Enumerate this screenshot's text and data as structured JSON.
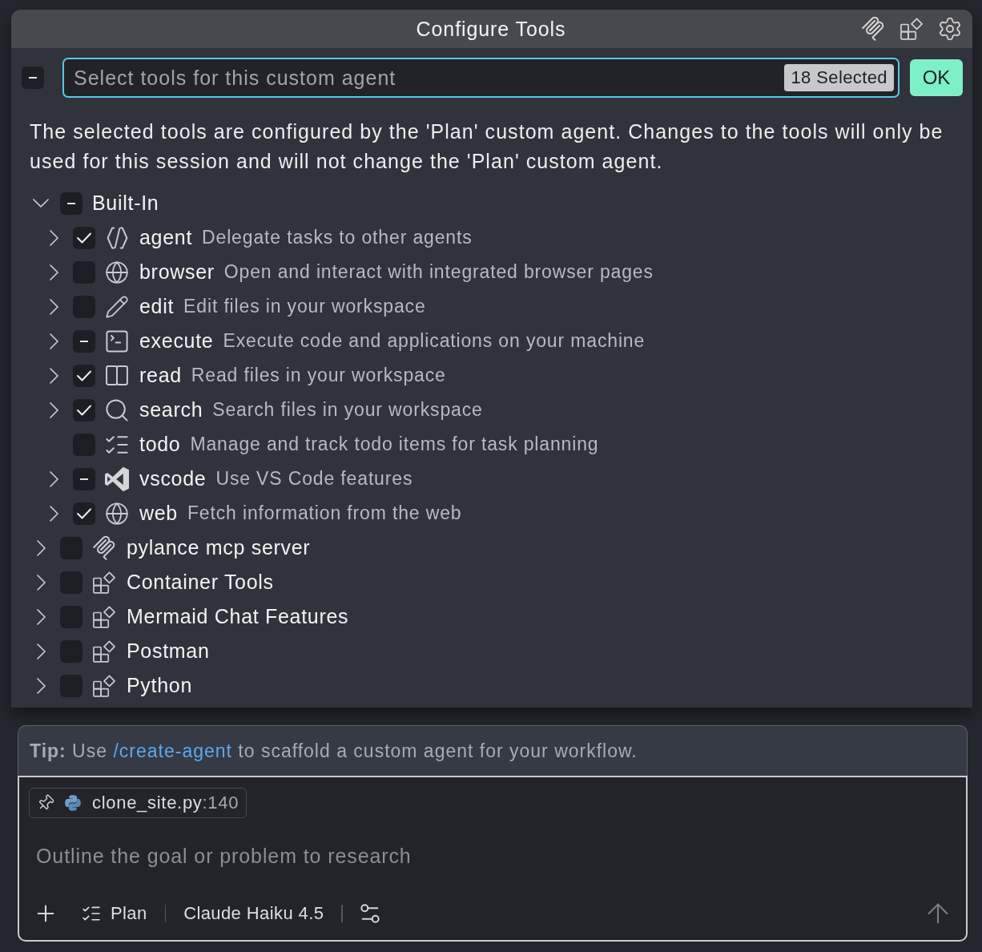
{
  "window": {
    "title": "Configure Tools"
  },
  "toggle_all": {
    "indeterminate": true
  },
  "search": {
    "placeholder": "Select tools for this custom agent",
    "badge": "18 Selected"
  },
  "ok_button": "OK",
  "description": "The selected tools are configured by the 'Plan' custom agent. Changes to the tools will only be used for this session and will not change the 'Plan' custom agent.",
  "tree": [
    {
      "label": "Built-In",
      "kind": "builtin",
      "expanded": true,
      "indeterminate": true,
      "children": [
        {
          "name": "agent",
          "description": "Delegate tasks to other agents",
          "expandable": true,
          "expanded": false,
          "checked": true
        },
        {
          "name": "browser",
          "description": "Open and interact with integrated browser pages",
          "expandable": true,
          "expanded": false,
          "checked": false
        },
        {
          "name": "edit",
          "description": "Edit files in your workspace",
          "expandable": true,
          "expanded": false,
          "checked": false
        },
        {
          "name": "execute",
          "description": "Execute code and applications on your machine",
          "expandable": true,
          "expanded": false,
          "indeterminate": true
        },
        {
          "name": "read",
          "description": "Read files in your workspace",
          "expandable": true,
          "expanded": false,
          "checked": true
        },
        {
          "name": "search",
          "description": "Search files in your workspace",
          "expandable": true,
          "expanded": false,
          "checked": true
        },
        {
          "name": "todo",
          "description": "Manage and track todo items for task planning",
          "expandable": false,
          "checked": false
        },
        {
          "name": "vscode",
          "description": "Use VS Code features",
          "expandable": true,
          "expanded": false,
          "indeterminate": true
        },
        {
          "name": "web",
          "description": "Fetch information from the web",
          "expandable": true,
          "expanded": false,
          "checked": true
        }
      ]
    },
    {
      "label": "pylance mcp server",
      "kind": "mcp_server",
      "expanded": false,
      "checked": false
    },
    {
      "label": "Container Tools",
      "kind": "extension",
      "expanded": false,
      "checked": false
    },
    {
      "label": "Mermaid Chat Features",
      "kind": "extension",
      "expanded": false,
      "checked": false
    },
    {
      "label": "Postman",
      "kind": "extension",
      "expanded": false,
      "checked": false
    },
    {
      "label": "Python",
      "kind": "extension",
      "expanded": false,
      "checked": false
    }
  ],
  "chat": {
    "tip": {
      "before": "**Tip:** Use",
      "link": "/create-agent",
      "after": "to scaffold a custom agent for your workflow."
    },
    "attachment": {
      "file": "clone_site.py",
      "line": ":140"
    },
    "placeholder": "Outline the goal or problem to research",
    "mode": "Plan",
    "model": "Claude Haiku 4.5"
  }
}
